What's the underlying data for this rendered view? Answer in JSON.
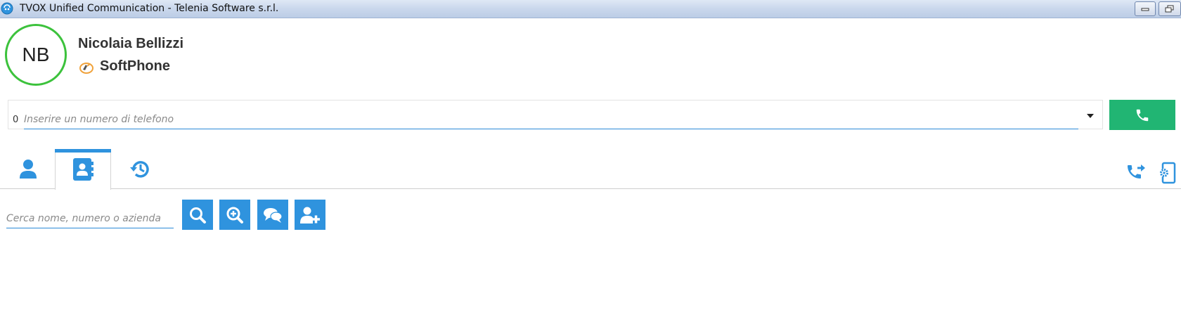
{
  "window": {
    "title": "TVOX Unified Communication - Telenia Software s.r.l."
  },
  "user": {
    "initials": "NB",
    "name": "Nicolaia Bellizzi",
    "device": "SoftPhone",
    "presence_color": "#3cc23c"
  },
  "dial": {
    "prefix": "0",
    "placeholder": "Inserire un numero di telefono",
    "value": ""
  },
  "tabs": [
    {
      "icon": "user-icon",
      "active": false
    },
    {
      "icon": "phonebook-icon",
      "active": true
    },
    {
      "icon": "history-icon",
      "active": false
    }
  ],
  "search": {
    "placeholder": "Cerca nome, numero o azienda",
    "value": ""
  },
  "colors": {
    "accent": "#2f93de",
    "call": "#21b573"
  }
}
